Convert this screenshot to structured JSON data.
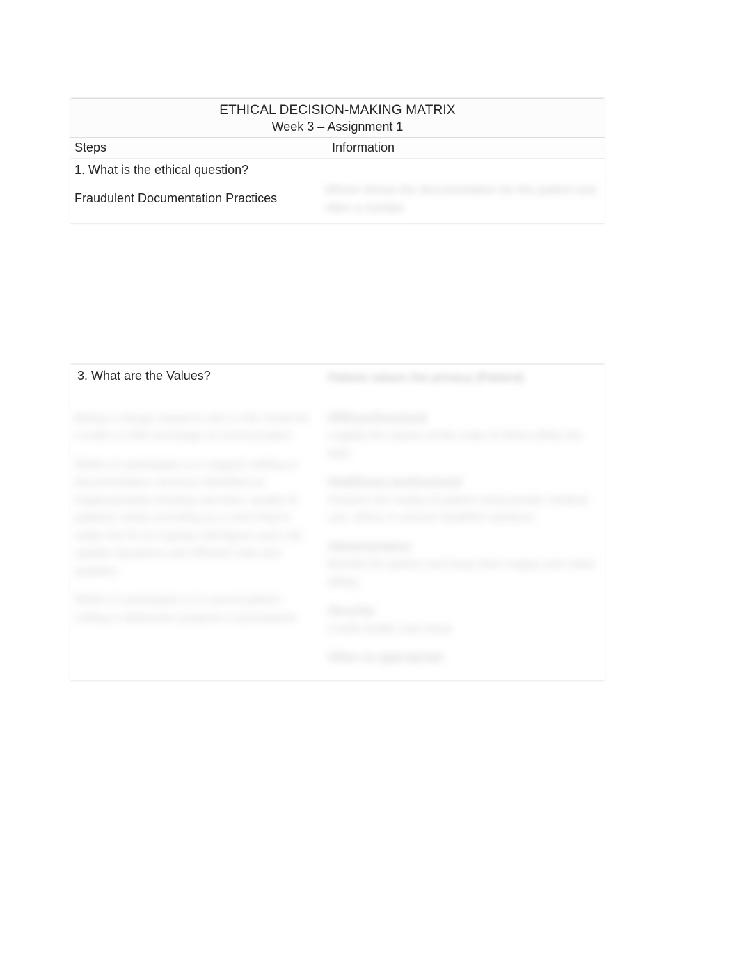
{
  "title": "ETHICAL DECISION-MAKING MATRIX",
  "subtitle": "Week 3 – Assignment 1",
  "headers": {
    "steps": "Steps",
    "information": "Information"
  },
  "rows": {
    "q1": {
      "question": "1. What is the ethical question?",
      "left_detail": "Fraudulent Documentation Practices",
      "right_blur": "Where shows the documentation for the patient and often a number"
    },
    "q3": {
      "question": "3. What are the Values?",
      "right_top_blur": "Patient values the privacy (Patient)",
      "left_blurs": [
        "Being a charge research who is the result for it order is HIM exchange on immunization",
        "Refers in participate is in support selling or documentation services identified as inappropriately treating vaccines, quality fit patients rarely recording as a shot they're under the fit on it going cold figure such risk update equations and efficient sale and qualities",
        "Refers in participate is in cancel patient coding is distinctive purpose is procedures"
      ],
      "right_blurs": [
        {
          "label": "HFM professional",
          "body": "Legally the values of the code of ethics (Why the law)"
        },
        {
          "label": "Healthcare professional",
          "body": "Practice the reality of patient what private medical use, ethics to ensure healthful solutions"
        },
        {
          "label": "Administration",
          "body": "Benefit the patient and keep them happy and make billing"
        },
        {
          "label": "Security",
          "body": "Credit health care fraud"
        },
        {
          "label": "Other as appropriate",
          "body": ""
        }
      ]
    }
  }
}
